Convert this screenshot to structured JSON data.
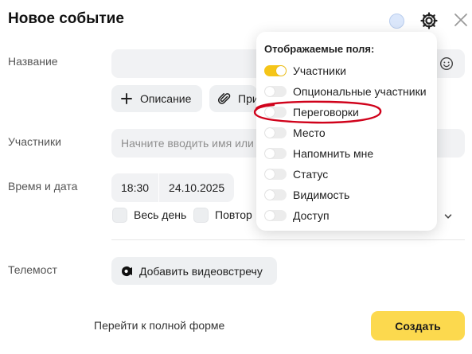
{
  "header": {
    "title": "Новое событие",
    "status_dot_icon": "avatar-dot-icon",
    "settings_icon": "gear-icon",
    "close_icon": "close-icon"
  },
  "form": {
    "name_label": "Название",
    "name_value": "",
    "emoji_icon": "smile-icon",
    "description_button": "Описание",
    "attach_button": "При",
    "participants_label": "Участники",
    "participants_placeholder": "Начните вводить имя или",
    "datetime_label": "Время и дата",
    "time": "18:30",
    "date": "24.10.2025",
    "all_day_label": "Весь день",
    "repeat_label": "Повтор",
    "expand_icon": "chevron-down-icon",
    "telemost_label": "Телемост",
    "add_meeting_button": "Добавить видеовстречу"
  },
  "fields_popover": {
    "title": "Отображаемые поля:",
    "items": [
      {
        "label": "Участники",
        "on": true
      },
      {
        "label": "Опциональные участники",
        "on": false
      },
      {
        "label": "Переговорки",
        "on": false
      },
      {
        "label": "Место",
        "on": false
      },
      {
        "label": "Напомнить мне",
        "on": false
      },
      {
        "label": "Статус",
        "on": false
      },
      {
        "label": "Видимость",
        "on": false
      },
      {
        "label": "Доступ",
        "on": false
      }
    ],
    "highlight_color": "#d0021b"
  },
  "footer": {
    "full_form_link": "Перейти к полной форме",
    "create_button": "Создать"
  },
  "colors": {
    "accent": "#fcd94e",
    "toggle_on": "#f5c518",
    "input_bg": "#f1f2f4"
  }
}
